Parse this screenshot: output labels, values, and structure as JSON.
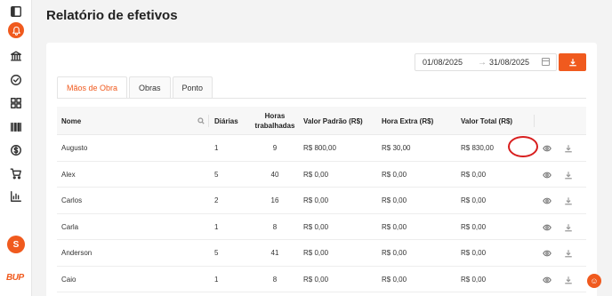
{
  "page": {
    "title": "Relatório de efetivos"
  },
  "sidebar": {
    "icons": [
      "panel-toggle-icon",
      "alert-icon",
      "bank-icon",
      "check-circle-icon",
      "grid-icon",
      "barcode-icon",
      "dollar-icon",
      "cart-icon",
      "chart-icon"
    ],
    "avatar_initial": "S",
    "logo_text": "BUP"
  },
  "filters": {
    "start_date": "01/08/2025",
    "arrow": "→",
    "end_date": "31/08/2025"
  },
  "tabs": [
    {
      "label": "Mãos de Obra",
      "active": true
    },
    {
      "label": "Obras",
      "active": false
    },
    {
      "label": "Ponto",
      "active": false
    }
  ],
  "table": {
    "headers": {
      "name": "Nome",
      "daily": "Diárias",
      "hours": "Horas trabalhadas",
      "standard": "Valor Padrão (R$)",
      "overtime": "Hora Extra (R$)",
      "total": "Valor Total (R$)"
    },
    "rows": [
      {
        "name": "Augusto",
        "daily": "1",
        "hours": "9",
        "standard": "R$ 800,00",
        "overtime": "R$ 30,00",
        "total": "R$ 830,00"
      },
      {
        "name": "Alex",
        "daily": "5",
        "hours": "40",
        "standard": "R$ 0,00",
        "overtime": "R$ 0,00",
        "total": "R$ 0,00"
      },
      {
        "name": "Carlos",
        "daily": "2",
        "hours": "16",
        "standard": "R$ 0,00",
        "overtime": "R$ 0,00",
        "total": "R$ 0,00"
      },
      {
        "name": "Carla",
        "daily": "1",
        "hours": "8",
        "standard": "R$ 0,00",
        "overtime": "R$ 0,00",
        "total": "R$ 0,00"
      },
      {
        "name": "Anderson",
        "daily": "5",
        "hours": "41",
        "standard": "R$ 0,00",
        "overtime": "R$ 0,00",
        "total": "R$ 0,00"
      },
      {
        "name": "Caio",
        "daily": "1",
        "hours": "8",
        "standard": "R$ 0,00",
        "overtime": "R$ 0,00",
        "total": "R$ 0,00"
      }
    ]
  },
  "colors": {
    "accent": "#f05a1e",
    "highlight": "#d81e1e"
  }
}
